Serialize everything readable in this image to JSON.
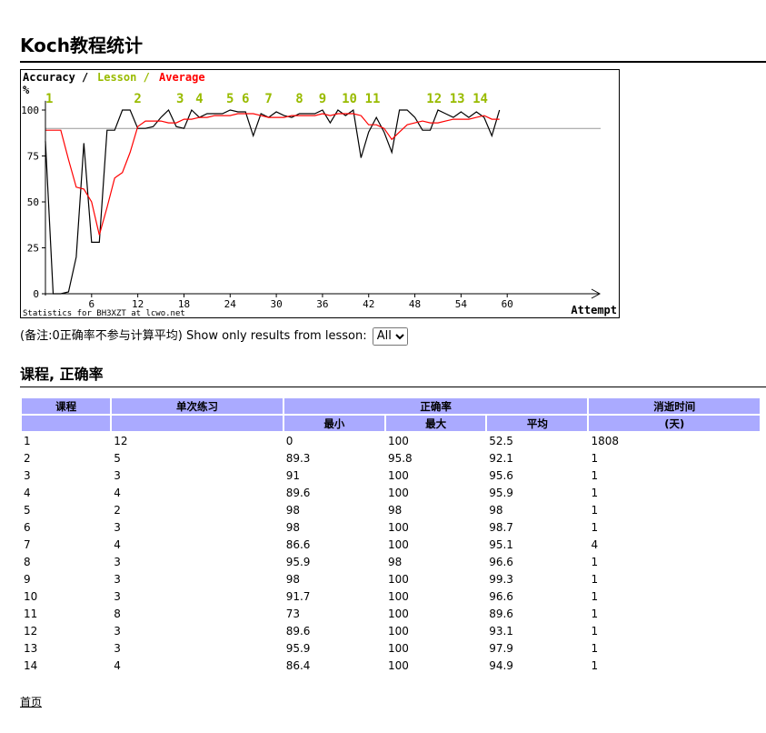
{
  "page": {
    "title": "Koch教程统计"
  },
  "chart": {
    "legend_accuracy": "Accuracy /",
    "legend_lesson": "Lesson /",
    "legend_average": "Average",
    "y_unit": "%",
    "x_title": "Attempt",
    "footer": "Statistics for BH3XZT at lcwo.net",
    "colors": {
      "accuracy": "#000000",
      "lesson": "#99bb00",
      "average": "#ff0000",
      "reference": "#999999"
    }
  },
  "chart_data": {
    "type": "line",
    "xlabel": "Attempt",
    "ylabel": "%",
    "xlim": [
      0,
      62
    ],
    "ylim": [
      0,
      100
    ],
    "x_ticks": [
      6,
      12,
      18,
      24,
      30,
      36,
      42,
      48,
      54,
      60
    ],
    "y_ticks": [
      0,
      25,
      50,
      75,
      100
    ],
    "reference_line": 90,
    "series": [
      {
        "name": "Accuracy",
        "x": [
          0,
          1,
          2,
          3,
          4,
          5,
          6,
          7,
          8,
          9,
          10,
          11,
          12,
          13,
          14,
          15,
          16,
          17,
          18,
          19,
          20,
          21,
          22,
          23,
          24,
          25,
          26,
          27,
          28,
          29,
          30,
          31,
          32,
          33,
          34,
          35,
          36,
          37,
          38,
          39,
          40,
          41,
          42,
          43,
          44,
          45,
          46,
          47,
          48,
          49,
          50,
          51,
          52,
          53,
          54,
          55,
          56,
          57,
          58,
          59
        ],
        "y": [
          83,
          0,
          0,
          1,
          20,
          82,
          28,
          28,
          89,
          89,
          100,
          100,
          90,
          90,
          91,
          96,
          100,
          91,
          90,
          100,
          96,
          98,
          98,
          98,
          100,
          99,
          99,
          86,
          98,
          96,
          99,
          97,
          96,
          98,
          98,
          98,
          100,
          93,
          100,
          97,
          100,
          74,
          88,
          96,
          88,
          77,
          100,
          100,
          96,
          89,
          89,
          100,
          98,
          96,
          99,
          96,
          99,
          96,
          86,
          100
        ]
      },
      {
        "name": "Average",
        "x": [
          0,
          1,
          2,
          3,
          4,
          5,
          6,
          7,
          8,
          9,
          10,
          11,
          12,
          13,
          14,
          15,
          16,
          17,
          18,
          19,
          20,
          21,
          22,
          23,
          24,
          25,
          26,
          27,
          28,
          29,
          30,
          31,
          32,
          33,
          34,
          35,
          36,
          37,
          38,
          39,
          40,
          41,
          42,
          43,
          44,
          45,
          46,
          47,
          48,
          49,
          50,
          51,
          52,
          53,
          54,
          55,
          56,
          57,
          58,
          59
        ],
        "y": [
          89,
          89,
          89,
          73,
          58,
          57,
          50,
          32,
          47,
          63,
          66,
          77,
          91,
          94,
          94,
          94,
          93,
          93,
          95,
          95,
          96,
          96,
          97,
          97,
          97,
          98,
          98,
          98,
          97,
          96,
          96,
          96,
          97,
          97,
          97,
          97,
          98,
          97,
          98,
          98,
          98,
          97,
          92,
          92,
          90,
          84,
          88,
          92,
          93,
          94,
          93,
          93,
          94,
          95,
          95,
          95,
          96,
          97,
          95,
          95
        ]
      }
    ],
    "lesson_marks": [
      {
        "label": "1",
        "x": 0.5
      },
      {
        "label": "2",
        "x": 12
      },
      {
        "label": "3",
        "x": 17.5
      },
      {
        "label": "4",
        "x": 20
      },
      {
        "label": "5",
        "x": 24
      },
      {
        "label": "6",
        "x": 26
      },
      {
        "label": "7",
        "x": 29
      },
      {
        "label": "8",
        "x": 33
      },
      {
        "label": "9",
        "x": 36
      },
      {
        "label": "10",
        "x": 39.5
      },
      {
        "label": "11",
        "x": 42.5
      },
      {
        "label": "12",
        "x": 50.5
      },
      {
        "label": "13",
        "x": 53.5
      },
      {
        "label": "14",
        "x": 56.5
      }
    ]
  },
  "filter": {
    "note": "(备注:0正确率不参与计算平均)",
    "label": "Show only results from lesson:",
    "selected": "All"
  },
  "section": {
    "title": "课程, 正确率"
  },
  "table": {
    "headers": {
      "lesson": "课程",
      "attempts": "单次练习",
      "accuracy": "正确率",
      "elapsed": "消逝时间",
      "min": "最小",
      "max": "最大",
      "avg": "平均",
      "days": "(天)"
    },
    "rows": [
      [
        "1",
        "12",
        "0",
        "100",
        "52.5",
        "1808"
      ],
      [
        "2",
        "5",
        "89.3",
        "95.8",
        "92.1",
        "1"
      ],
      [
        "3",
        "3",
        "91",
        "100",
        "95.6",
        "1"
      ],
      [
        "4",
        "4",
        "89.6",
        "100",
        "95.9",
        "1"
      ],
      [
        "5",
        "2",
        "98",
        "98",
        "98",
        "1"
      ],
      [
        "6",
        "3",
        "98",
        "100",
        "98.7",
        "1"
      ],
      [
        "7",
        "4",
        "86.6",
        "100",
        "95.1",
        "4"
      ],
      [
        "8",
        "3",
        "95.9",
        "98",
        "96.6",
        "1"
      ],
      [
        "9",
        "3",
        "98",
        "100",
        "99.3",
        "1"
      ],
      [
        "10",
        "3",
        "91.7",
        "100",
        "96.6",
        "1"
      ],
      [
        "11",
        "8",
        "73",
        "100",
        "89.6",
        "1"
      ],
      [
        "12",
        "3",
        "89.6",
        "100",
        "93.1",
        "1"
      ],
      [
        "13",
        "3",
        "95.9",
        "100",
        "97.9",
        "1"
      ],
      [
        "14",
        "4",
        "86.4",
        "100",
        "94.9",
        "1"
      ]
    ]
  },
  "footer": {
    "home_link": "首页"
  }
}
